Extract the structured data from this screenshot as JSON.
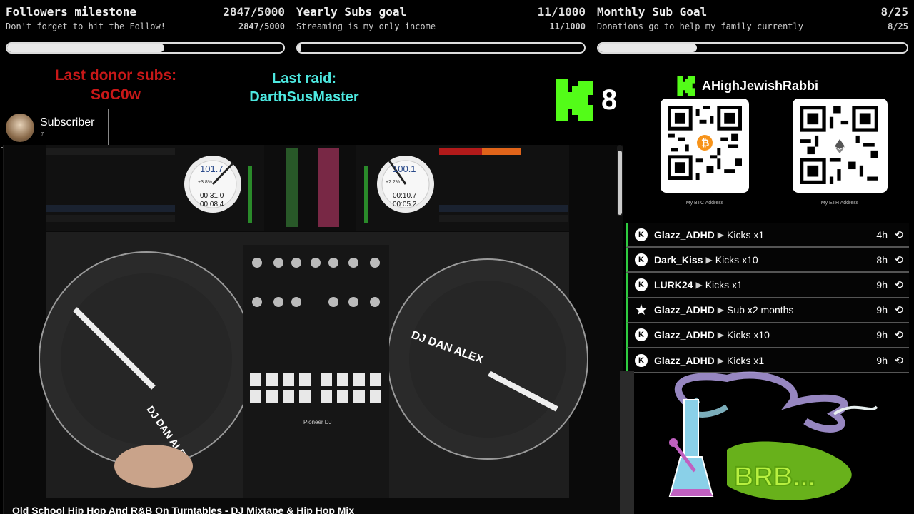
{
  "goals": [
    {
      "title": "Followers milestone",
      "count": "2847/5000",
      "subtitle": "Don't forget to hit the Follow!",
      "count2": "2847/5000",
      "progress": 0.569
    },
    {
      "title": "Yearly Subs goal",
      "count": "11/1000",
      "subtitle": "Streaming is my only income",
      "count2": "11/1000",
      "progress": 0.011
    },
    {
      "title": "Monthly Sub Goal",
      "count": "8/25",
      "subtitle": "Donations go to help my family currently",
      "count2": "8/25",
      "progress": 0.32
    }
  ],
  "donor": {
    "label": "Last donor subs:",
    "name": "SoC0w"
  },
  "raid": {
    "label": "Last raid:",
    "name": "DarthSusMaster"
  },
  "kick_counter": {
    "value": "8"
  },
  "subscriber": {
    "label": "Subscriber",
    "small": "7"
  },
  "streamer": {
    "name": "AHighJewishRabbi"
  },
  "qr": [
    {
      "label": "My BTC Address",
      "coin_icon": "bitcoin-icon"
    },
    {
      "label": "My ETH Address",
      "coin_icon": "ethereum-icon"
    }
  ],
  "events": [
    {
      "icon": "kick-icon",
      "user": "Glazz_ADHD",
      "action": "Kicks x1",
      "time": "4h"
    },
    {
      "icon": "kick-icon",
      "user": "Dark_Kiss",
      "action": "Kicks x10",
      "time": "8h"
    },
    {
      "icon": "kick-icon",
      "user": "LURK24",
      "action": "Kicks x1",
      "time": "9h"
    },
    {
      "icon": "star-icon",
      "user": "Glazz_ADHD",
      "action": "Sub x2 months",
      "time": "9h"
    },
    {
      "icon": "kick-icon",
      "user": "Glazz_ADHD",
      "action": "Kicks x10",
      "time": "9h"
    },
    {
      "icon": "kick-icon",
      "user": "Glazz_ADHD",
      "action": "Kicks x1",
      "time": "9h"
    }
  ],
  "video": {
    "caption": "Old School Hip Hop And R&B On Turntables - DJ Mixtape & Hip Hop Mix",
    "deck_left": {
      "bpm": "101.7",
      "pitch": "+3.8%",
      "elapsed": "00:31.0",
      "remain": "00:08.4"
    },
    "deck_right": {
      "bpm": "100.1",
      "pitch": "+2.2%",
      "elapsed": "00:10.7",
      "remain": "00:05.2"
    },
    "turntable_text": "DJ DAN ALEX",
    "mixer_brand": "Pioneer DJ"
  },
  "brb": {
    "text": "BRB..."
  },
  "colors": {
    "kick_green": "#53fc18",
    "donor_red": "#c81818",
    "raid_cyan": "#4de8e0"
  }
}
